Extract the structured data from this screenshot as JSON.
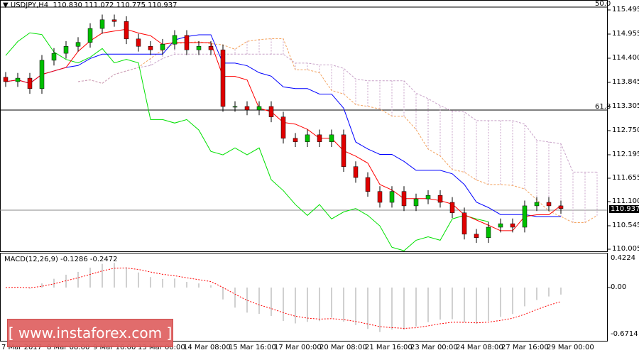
{
  "header": {
    "symbol": "USDJPY,H4",
    "ohlc": "110.830 111.072 110.775 110.937"
  },
  "price_axis": [
    "115.495",
    "114.955",
    "114.400",
    "113.845",
    "113.305",
    "112.750",
    "112.195",
    "111.655",
    "111.100",
    "110.545",
    "110.005"
  ],
  "current_price": "110.937",
  "fib_levels": [
    "50.0",
    "61.8"
  ],
  "macd": {
    "label": "MACD(12,26,9) -0.1286 -0.2472",
    "axis": [
      "0.4224",
      "0.00",
      "-0.6714"
    ]
  },
  "dates": [
    "7 Mar 2017",
    "8 Mar 08:00",
    "9 Mar 16:00",
    "13 Mar 00:00",
    "14 Mar 08:00",
    "15 Mar 16:00",
    "17 Mar 00:00",
    "20 Mar 08:00",
    "21 Mar 16:00",
    "23 Mar 00:00",
    "24 Mar 08:00",
    "27 Mar 16:00",
    "29 Mar 00:00"
  ],
  "watermark": "[ www.instaforex.com ]",
  "colors": {
    "bull": "#00c000",
    "bear": "#e00000",
    "tenkan": "#ff0000",
    "kijun": "#0000ff",
    "chikou": "#00e000",
    "cloud_a": "#f4a460",
    "cloud_b": "#c8a2c8",
    "macd_signal": "#ff0000",
    "macd_hist": "#c0c0c0"
  },
  "chart_data": {
    "type": "candlestick",
    "closes": [
      113.85,
      113.93,
      113.69,
      114.34,
      114.5,
      114.66,
      114.75,
      115.07,
      115.27,
      115.23,
      114.83,
      114.66,
      114.58,
      114.71,
      114.91,
      114.58,
      114.66,
      114.58,
      113.28,
      113.28,
      113.2,
      113.28,
      113.04,
      112.55,
      112.47,
      112.63,
      112.47,
      112.63,
      111.9,
      111.65,
      111.33,
      111.08,
      111.33,
      111.0,
      111.16,
      111.24,
      111.08,
      110.84,
      110.35,
      110.27,
      110.51,
      110.59,
      110.51,
      111.0,
      111.08,
      111.0,
      110.937
    ],
    "ylim": [
      110.005,
      115.495
    ]
  }
}
